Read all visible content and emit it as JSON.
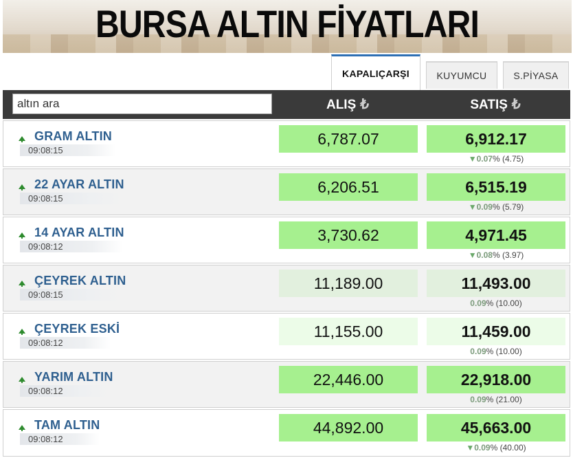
{
  "banner": {
    "title": "BURSA ALTIN FİYATLARI"
  },
  "tabs": [
    {
      "label": "KAPALIÇARŞI",
      "active": true
    },
    {
      "label": "KUYUMCU",
      "active": false
    },
    {
      "label": "S.PİYASA",
      "active": false
    }
  ],
  "search": {
    "value": "altın ara"
  },
  "columns": {
    "buy": "ALIŞ",
    "sell": "SATIŞ",
    "currency_icon": "₺"
  },
  "colors": {
    "header_bg": "#3a3a3a",
    "price_green": "#a6f08f",
    "name_blue": "#2e5f8f",
    "up_arrow": "#2e8b2e"
  },
  "rows": [
    {
      "name": "GRAM ALTIN",
      "time": "09:08:15",
      "buy": "6,787.07",
      "sell": "6,912.17",
      "pct": "0.07",
      "pct_sign": "%",
      "diff": "(4.75)",
      "arrow": "▼"
    },
    {
      "name": "22 AYAR ALTIN",
      "time": "09:08:15",
      "buy": "6,206.51",
      "sell": "6,515.19",
      "pct": "0.09",
      "pct_sign": "%",
      "diff": "(5.79)",
      "arrow": "▼"
    },
    {
      "name": "14 AYAR ALTIN",
      "time": "09:08:12",
      "buy": "3,730.62",
      "sell": "4,971.45",
      "pct": "0.08",
      "pct_sign": "%",
      "diff": "(3.97)",
      "arrow": "▼"
    },
    {
      "name": "ÇEYREK ALTIN",
      "time": "09:08:15",
      "buy": "11,189.00",
      "sell": "11,493.00",
      "pct": "0.09",
      "pct_sign": "%",
      "diff": "(10.00)",
      "arrow": ""
    },
    {
      "name": "ÇEYREK ESKİ",
      "time": "09:08:12",
      "buy": "11,155.00",
      "sell": "11,459.00",
      "pct": "0.09",
      "pct_sign": "%",
      "diff": "(10.00)",
      "arrow": ""
    },
    {
      "name": "YARIM ALTIN",
      "time": "09:08:12",
      "buy": "22,446.00",
      "sell": "22,918.00",
      "pct": "0.09",
      "pct_sign": "%",
      "diff": "(21.00)",
      "arrow": ""
    },
    {
      "name": "TAM ALTIN",
      "time": "09:08:12",
      "buy": "44,892.00",
      "sell": "45,663.00",
      "pct": "0.09",
      "pct_sign": "%",
      "diff": "(40.00)",
      "arrow": "▼"
    }
  ]
}
